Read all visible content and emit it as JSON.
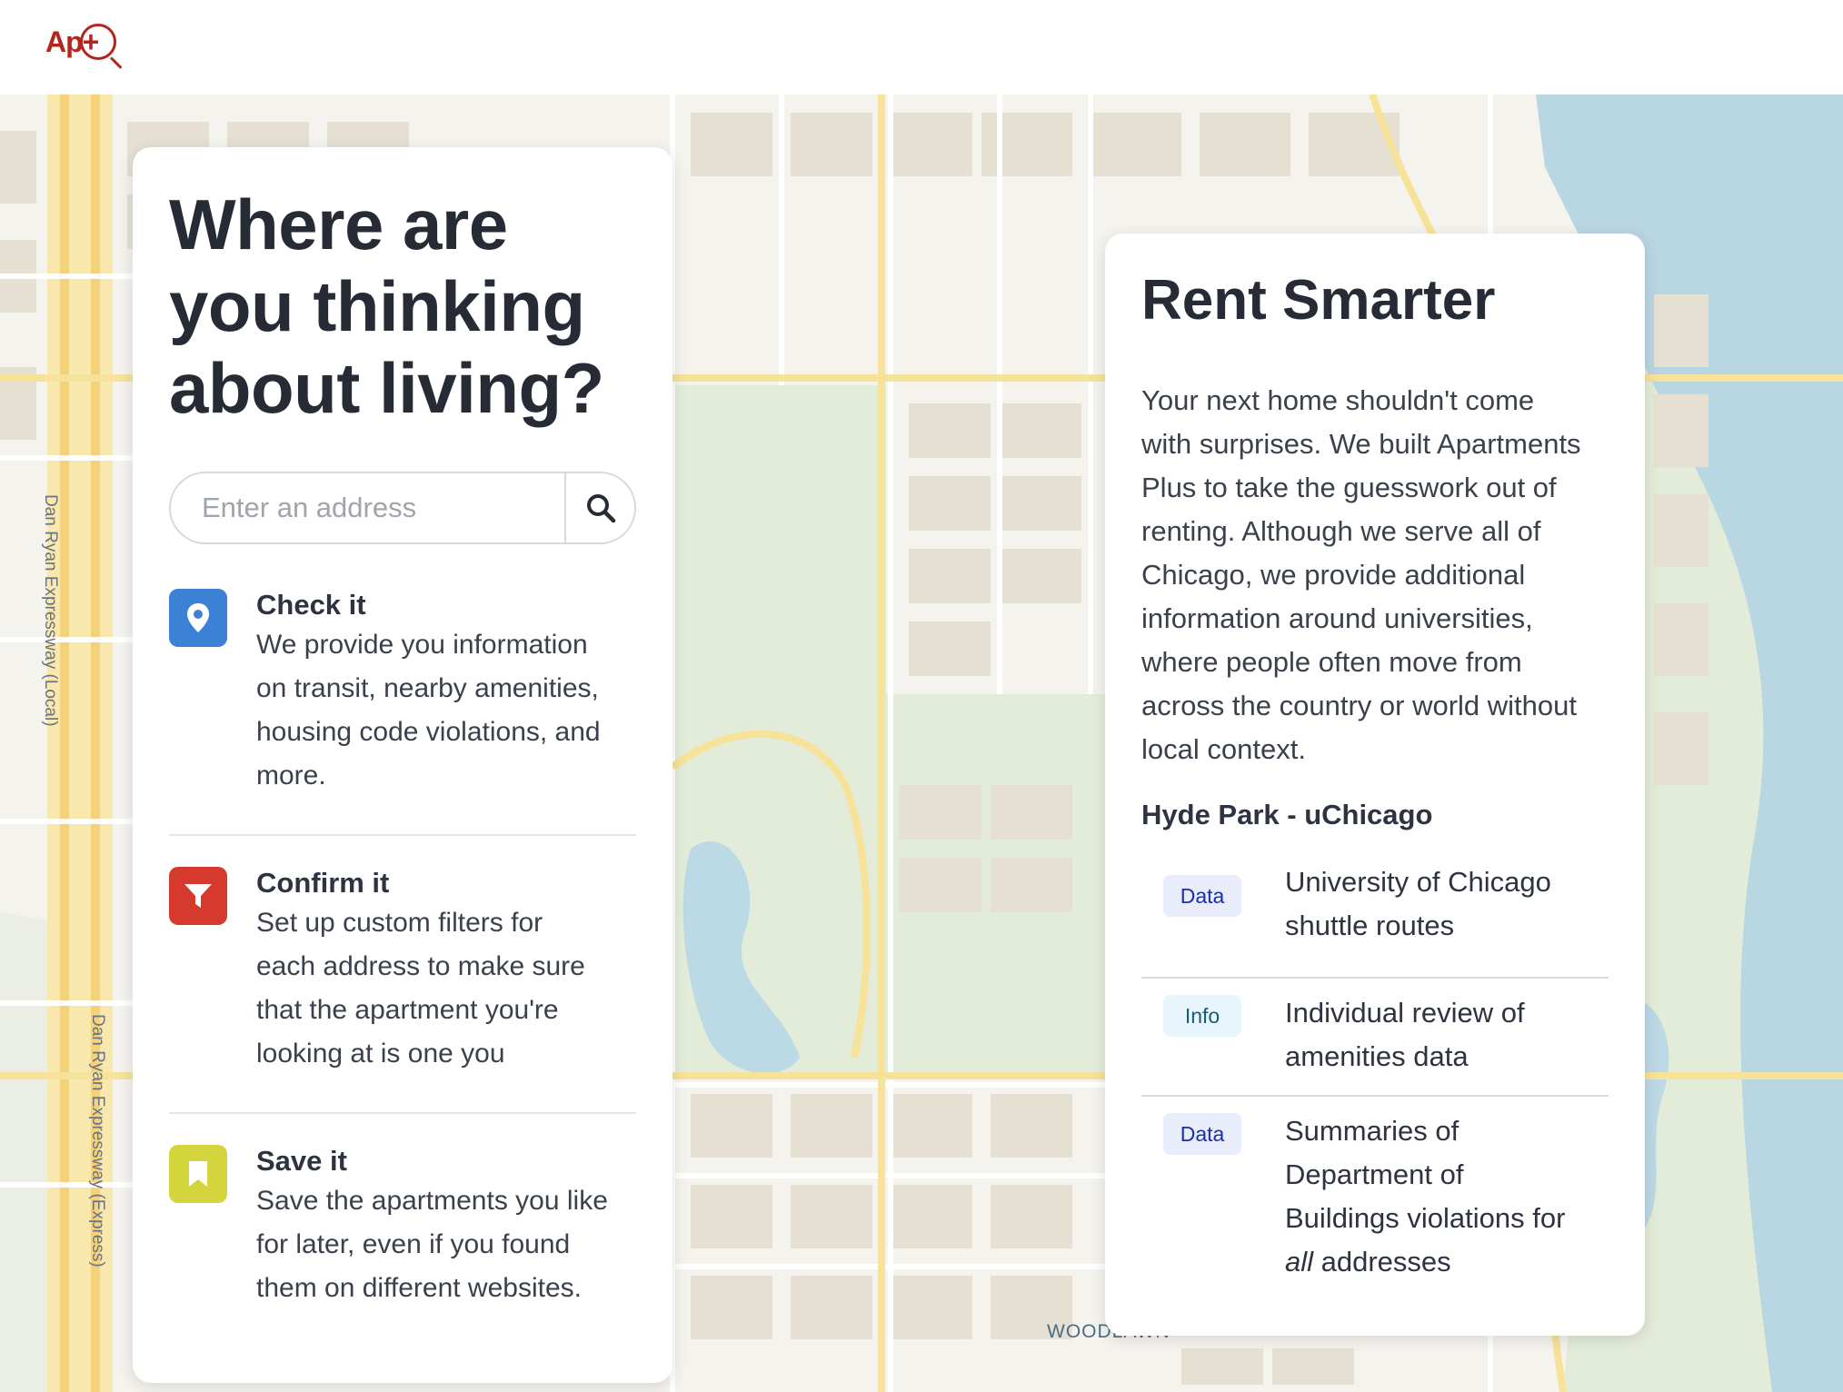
{
  "header": {
    "logo_text": "Ap+",
    "logo_icon": "magnifier-icon"
  },
  "map": {
    "road_label_1": "Dan Ryan Expressway (Local)",
    "road_label_2": "Dan Ryan Expressway (Express)",
    "neighborhood_label": "WOODLAWN",
    "colors": {
      "land": "#f5f3ee",
      "park": "#e3ecd8",
      "water": "#b9d6e3",
      "road": "#f7e6a6",
      "building": "#e8e2d6"
    }
  },
  "hero": {
    "title_line1": "Where are",
    "title_line2": "you thinking",
    "title_line3": "about living?",
    "search_placeholder": "Enter an address",
    "search_icon": "search-icon"
  },
  "features": [
    {
      "title": "Check it",
      "icon": "map-pin-icon",
      "color": "#3b82d6",
      "lines": [
        "We provide you information",
        "on transit, nearby amenities,",
        "housing code violations, and",
        "more."
      ]
    },
    {
      "title": "Confirm it",
      "icon": "filter-icon",
      "color": "#d63a2e",
      "lines": [
        "Set up custom filters for",
        "each address to make sure",
        "that the apartment you're",
        "looking at is one you"
      ]
    },
    {
      "title": "Save it",
      "icon": "bookmark-icon",
      "color": "#d4d43c",
      "lines": [
        "Save the apartments you like",
        "for later, even if you found",
        "them on different websites."
      ]
    }
  ],
  "rent_smarter": {
    "title": "Rent Smarter",
    "lines": [
      "Your next home shouldn't come",
      "with surprises. We built Apartments",
      "Plus to take the guesswork out of",
      "renting. Although we serve all of",
      "Chicago, we provide additional",
      "information around universities,",
      "where people often move from",
      "across the country or world without",
      "local context."
    ],
    "subheading": "Hyde Park - uChicago",
    "items": [
      {
        "badge": "Data",
        "line1": "University of Chicago",
        "line2": "shuttle routes"
      },
      {
        "badge": "Info",
        "line1": "Individual review of",
        "line2": "amenities data"
      },
      {
        "badge": "Data",
        "line1": "Summaries of",
        "line2": "Department of",
        "line3": "Buildings violations for",
        "emph": "all",
        "rest": " addresses"
      }
    ]
  }
}
